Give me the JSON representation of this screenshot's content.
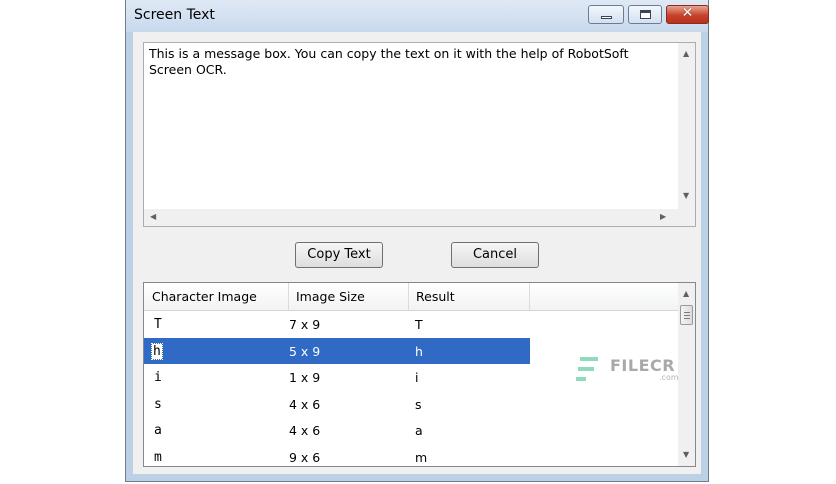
{
  "window": {
    "title": "Screen Text",
    "close_glyph": "✕"
  },
  "textbox": {
    "content": "This is a message box. You can copy the text on it with the help of RobotSoft Screen OCR."
  },
  "buttons": {
    "copy_label": "Copy Text",
    "cancel_label": "Cancel"
  },
  "list": {
    "columns": [
      "Character Image",
      "Image Size",
      "Result"
    ],
    "rows": [
      {
        "image": "T",
        "size": "7 x 9",
        "result": "T"
      },
      {
        "image": "h",
        "size": "5 x 9",
        "result": "h",
        "selected": true
      },
      {
        "image": "i",
        "size": "1 x 9",
        "result": "i"
      },
      {
        "image": "s",
        "size": "4 x 6",
        "result": "s"
      },
      {
        "image": "a",
        "size": "4 x 6",
        "result": "a"
      },
      {
        "image": "m",
        "size": "9 x 6",
        "result": "m"
      }
    ]
  },
  "watermark": {
    "brand": "FILECR",
    "suffix": ".com"
  },
  "colors": {
    "selection": "#316ac5",
    "title_bar": "#c8d9ec",
    "close_button": "#c5432b",
    "watermark_green": "#7fd4b0"
  },
  "icons": [
    "minimize-icon",
    "maximize-icon",
    "close-icon",
    "scroll-up-icon",
    "scroll-down-icon",
    "scroll-left-icon",
    "scroll-right-icon"
  ]
}
